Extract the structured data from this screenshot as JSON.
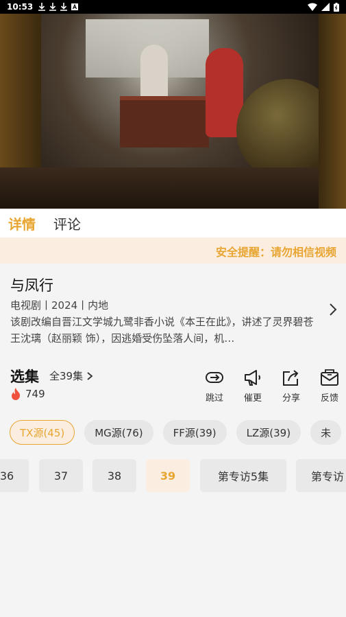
{
  "status_bar": {
    "time": "10:53",
    "icons": [
      "download-icon",
      "download-icon",
      "download-icon",
      "a-icon"
    ],
    "right_icons": [
      "wifi-icon",
      "signal-icon",
      "battery-icon"
    ]
  },
  "tabs": [
    {
      "label": "详情",
      "active": true
    },
    {
      "label": "评论",
      "active": false
    }
  ],
  "notice": "安全提醒：请勿相信视频",
  "show": {
    "title": "与凤行",
    "meta": "电视剧丨2024丨内地",
    "description": "该剧改编自晋江文学城九鹭非香小说《本王在此》，讲述了灵界碧苍王沈璃（赵丽颖 饰），因逃婚受伤坠落人间，机…"
  },
  "episodes_header": {
    "title": "选集",
    "all_label": "全39集",
    "hot_count": "749"
  },
  "actions": [
    {
      "label": "跳过",
      "icon": "skip-icon"
    },
    {
      "label": "催更",
      "icon": "megaphone-icon"
    },
    {
      "label": "分享",
      "icon": "share-icon"
    },
    {
      "label": "反馈",
      "icon": "feedback-icon"
    }
  ],
  "sources": [
    {
      "label": "TX源(45)",
      "active": true
    },
    {
      "label": "MG源(76)",
      "active": false
    },
    {
      "label": "FF源(39)",
      "active": false
    },
    {
      "label": "LZ源(39)",
      "active": false
    },
    {
      "label": "未",
      "active": false
    }
  ],
  "episodes": [
    {
      "label": "36",
      "active": false
    },
    {
      "label": "37",
      "active": false
    },
    {
      "label": "38",
      "active": false
    },
    {
      "label": "39",
      "active": true
    },
    {
      "label": "第专访5集",
      "active": false
    },
    {
      "label": "第专访",
      "active": false
    }
  ],
  "colors": {
    "accent": "#e8a531",
    "notice_bg": "#fbeee0",
    "hot": "#f0513c"
  }
}
